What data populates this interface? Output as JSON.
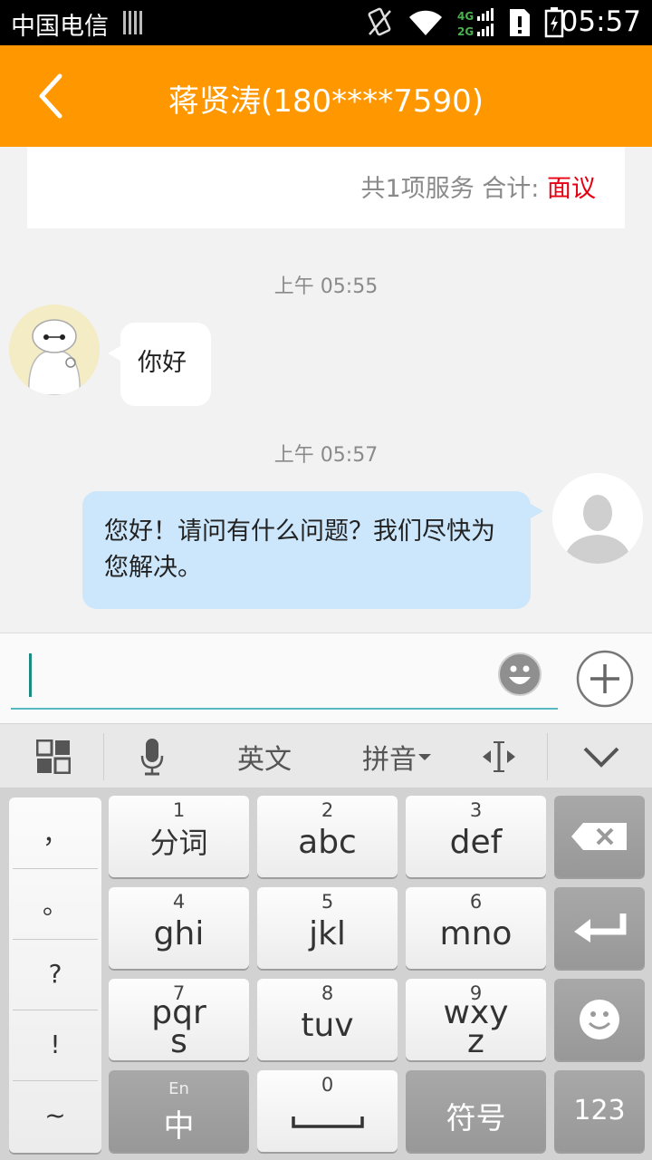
{
  "status_bar": {
    "carrier": "中国电信",
    "network_4g": "4G",
    "network_2g": "2G",
    "time": "05:57",
    "icons": [
      "signal-bars-icon",
      "vibrate-icon",
      "wifi-icon",
      "cellular-icon",
      "sim-alert-icon",
      "battery-charging-icon"
    ]
  },
  "header": {
    "title": "蒋贤涛(180****7590)",
    "back_icon": "chevron-left-icon",
    "background": "#ff9800"
  },
  "summary": {
    "text": "共1项服务 合计: ",
    "price": "面议",
    "price_color": "#e60012"
  },
  "messages": [
    {
      "timestamp": "上午 05:55",
      "side": "left",
      "text": "你好"
    },
    {
      "timestamp": "上午 05:57",
      "side": "right",
      "text": "您好！请问有什么问题？我们尽快为您解决。"
    }
  ],
  "input": {
    "value": "",
    "emoji_icon": "smiley-icon",
    "plus_icon": "plus-circle-icon"
  },
  "ime_toolbar": {
    "grid_icon": "grid-icon",
    "mic_icon": "microphone-icon",
    "english": "英文",
    "pinyin": "拼音",
    "cursor_icon": "cursor-move-icon",
    "collapse_icon": "chevron-down-icon"
  },
  "keyboard": {
    "punctuation": [
      "，",
      "。",
      "?",
      "!",
      "~"
    ],
    "keys": [
      {
        "num": "1",
        "label": "分词"
      },
      {
        "num": "2",
        "label": "abc"
      },
      {
        "num": "3",
        "label": "def"
      },
      {
        "num": "4",
        "label": "ghi"
      },
      {
        "num": "5",
        "label": "jkl"
      },
      {
        "num": "6",
        "label": "mno"
      },
      {
        "num": "7",
        "label": "pqr",
        "label2": "s"
      },
      {
        "num": "8",
        "label": "tuv"
      },
      {
        "num": "9",
        "label": "wxy",
        "label2": "z"
      }
    ],
    "lang_small": "En",
    "lang_main": "中",
    "space_num": "0",
    "symbols": "符号",
    "numbers": "123",
    "backspace_icon": "backspace-icon",
    "enter_icon": "enter-icon",
    "emoji_icon": "smiley-icon"
  }
}
